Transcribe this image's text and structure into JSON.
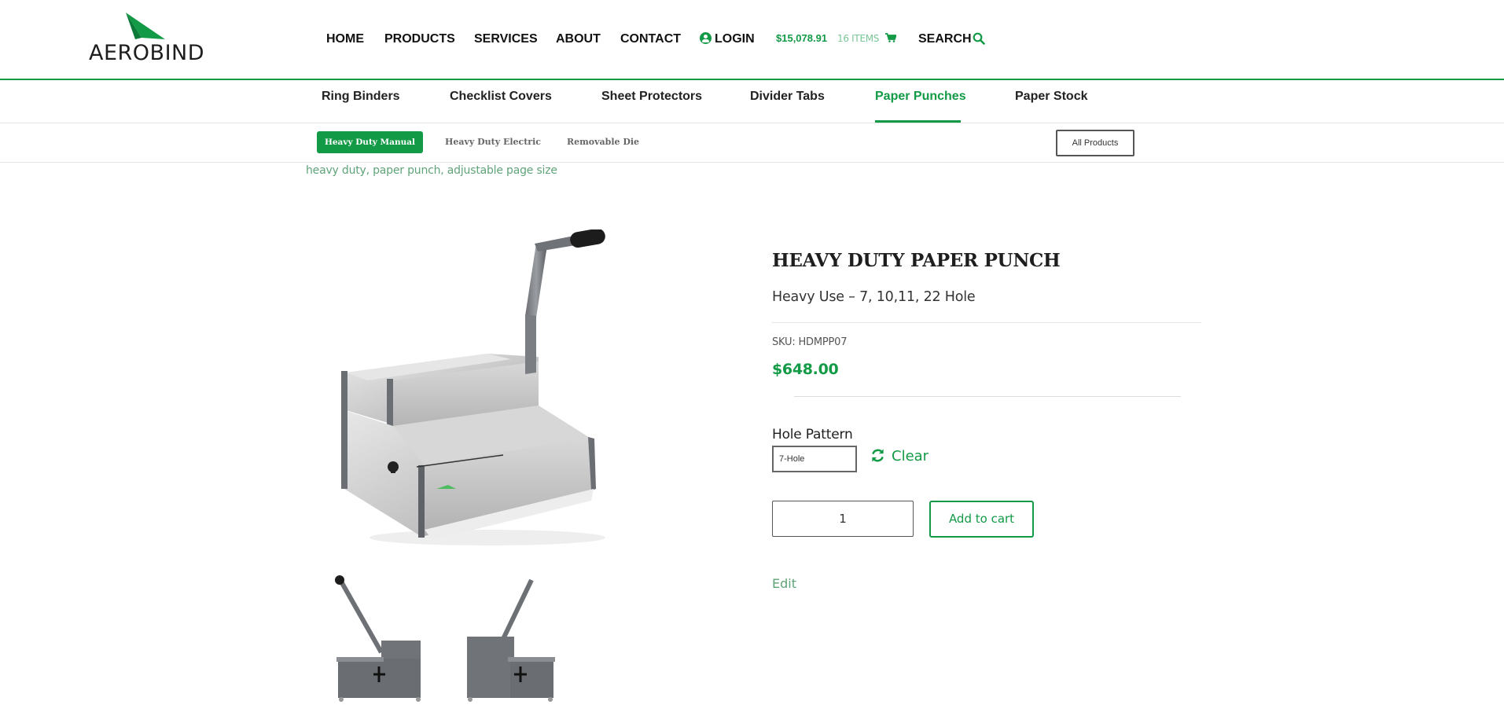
{
  "header": {
    "logo_text": "AEROBIND",
    "nav": {
      "home": "HOME",
      "products": "PRODUCTS",
      "services": "SERVICES",
      "about": "ABOUT",
      "contact": "CONTACT",
      "login": "LOGIN",
      "search": "SEARCH"
    },
    "cart": {
      "total": "$15,078.91",
      "items": "16 ITEMS"
    }
  },
  "categories": {
    "ring_binders": "Ring Binders",
    "checklist_covers": "Checklist Covers",
    "sheet_protectors": "Sheet Protectors",
    "divider_tabs": "Divider Tabs",
    "paper_punches": "Paper Punches",
    "paper_stock": "Paper Stock"
  },
  "subcategories": {
    "heavy_duty_manual": "Heavy Duty Manual",
    "heavy_duty_electric": "Heavy Duty Electric",
    "removable_die": "Removable Die",
    "all_products": "All Products"
  },
  "tags": "heavy duty, paper punch, adjustable page size",
  "product": {
    "title": "HEAVY DUTY PAPER PUNCH",
    "subtitle": "Heavy Use – 7, 10,11, 22 Hole",
    "sku": "SKU: HDMPP07",
    "price": "$648.00",
    "attribute_label": "Hole Pattern",
    "attribute_value": "7-Hole",
    "clear_label": "Clear",
    "quantity": "1",
    "add_to_cart": "Add to cart",
    "edit": "Edit"
  },
  "colors": {
    "brand_green": "#129a46",
    "light_green": "#7ac596",
    "tag_green": "#5fa378"
  }
}
